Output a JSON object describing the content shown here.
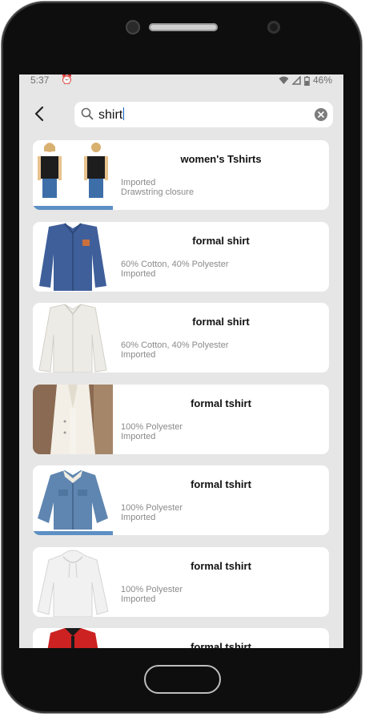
{
  "status": {
    "time": "5:37",
    "battery": "46%"
  },
  "search": {
    "query": "shirt"
  },
  "products": [
    {
      "title": "women's Tshirts",
      "line1": "Imported",
      "line2": "Drawstring closure",
      "thumb": "tshirt-pair"
    },
    {
      "title": "formal shirt",
      "line1": "60% Cotton, 40% Polyester",
      "line2": "Imported",
      "thumb": "denim-shirt"
    },
    {
      "title": "formal shirt",
      "line1": "60% Cotton, 40% Polyester",
      "line2": "Imported",
      "thumb": "white-shirt"
    },
    {
      "title": "formal tshirt",
      "line1": "100% Polyester",
      "line2": "Imported",
      "thumb": "trench-coat"
    },
    {
      "title": "formal tshirt",
      "line1": "100% Polyester",
      "line2": "Imported",
      "thumb": "denim-jacket"
    },
    {
      "title": "formal tshirt",
      "line1": "100% Polyester",
      "line2": "Imported",
      "thumb": "white-hoodie"
    },
    {
      "title": "formal tshirt",
      "line1": "",
      "line2": "",
      "thumb": "red-jacket"
    }
  ],
  "colors": {
    "background": "#e6e6e6",
    "card": "#ffffff",
    "caret": "#1565c0"
  }
}
